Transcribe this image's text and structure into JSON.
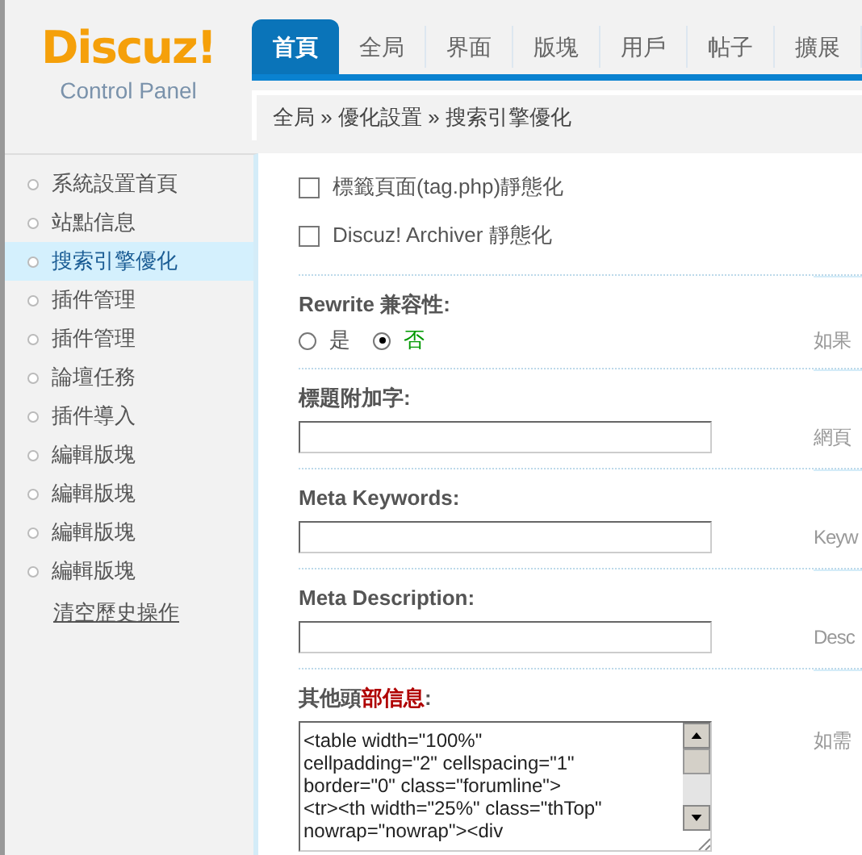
{
  "logo": {
    "title": "Discuz!",
    "subtitle": "Control Panel"
  },
  "tabs": [
    {
      "label": "首頁",
      "selected": true
    },
    {
      "label": "全局",
      "selected": false
    },
    {
      "label": "界面",
      "selected": false
    },
    {
      "label": "版塊",
      "selected": false
    },
    {
      "label": "用戶",
      "selected": false
    },
    {
      "label": "帖子",
      "selected": false
    },
    {
      "label": "擴展",
      "selected": false
    }
  ],
  "breadcrumb": "全局 » 優化設置 » 搜索引擎優化",
  "sidebar": {
    "items": [
      {
        "label": "系統設置首頁",
        "selected": false
      },
      {
        "label": "站點信息",
        "selected": false
      },
      {
        "label": "搜索引擎優化",
        "selected": true
      },
      {
        "label": "插件管理",
        "selected": false
      },
      {
        "label": "插件管理",
        "selected": false
      },
      {
        "label": "論壇任務",
        "selected": false
      },
      {
        "label": "插件導入",
        "selected": false
      },
      {
        "label": "編輯版塊",
        "selected": false
      },
      {
        "label": "編輯版塊",
        "selected": false
      },
      {
        "label": "編輯版塊",
        "selected": false
      },
      {
        "label": "編輯版塊",
        "selected": false
      }
    ],
    "link": "清空歷史操作"
  },
  "settings": [
    {
      "kind": "checkboxes",
      "options": [
        {
          "label": "標籤頁面(tag.php)靜態化",
          "checked": false
        },
        {
          "label": "Discuz! Archiver 靜態化",
          "checked": false
        }
      ]
    },
    {
      "kind": "radio",
      "label": "Rewrite 兼容性:",
      "options": [
        {
          "label": "是",
          "selected": false
        },
        {
          "label": "否",
          "selected": true
        }
      ],
      "hint": "如果"
    },
    {
      "kind": "input",
      "label": "標題附加字:",
      "hint": "網頁"
    },
    {
      "kind": "input",
      "label": "Meta Keywords:",
      "hint": "Keyw"
    },
    {
      "kind": "input",
      "label": "Meta Description:",
      "hint": "Desc"
    },
    {
      "kind": "textarea",
      "label": "其他頭**部信息**:",
      "value": "<table width=\"100%\"\ncellpadding=\"2\" cellspacing=\"1\"\nborder=\"0\" class=\"forumline\">\n<tr><th width=\"25%\" class=\"thTop\"\nnowrap=\"nowrap\"><div",
      "hint": "如需"
    }
  ]
}
